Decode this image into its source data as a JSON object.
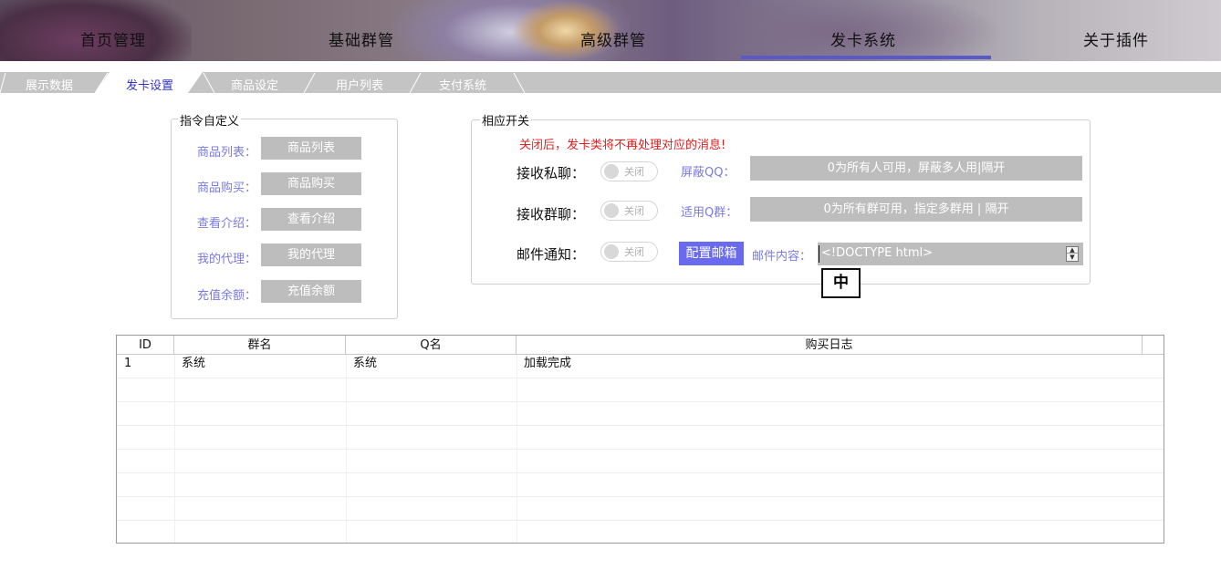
{
  "nav": {
    "items": [
      "首页管理",
      "基础群管",
      "高级群管",
      "发卡系统",
      "关于插件"
    ],
    "active_index": 3,
    "active_color": "#5959c8"
  },
  "tabs": {
    "items": [
      "展示数据",
      "发卡设置",
      "商品设定",
      "用户列表",
      "支付系统"
    ],
    "active_index": 1,
    "active_color": "#3333cc"
  },
  "commands": {
    "title": "指令自定义",
    "items": [
      {
        "label": "商品列表：",
        "value": "商品列表"
      },
      {
        "label": "商品购买：",
        "value": "商品购买"
      },
      {
        "label": "查看介绍：",
        "value": "查看介绍"
      },
      {
        "label": "我的代理：",
        "value": "我的代理"
      },
      {
        "label": "充值余额：",
        "value": "充值余额"
      }
    ]
  },
  "switches": {
    "title": "相应开关",
    "warning": "关闭后，发卡类将不再处理对应的消息!",
    "private_chat": {
      "label": "接收私聊：",
      "toggle": "关闭",
      "side_label": "屏蔽QQ：",
      "placeholder": "0为所有人可用，屏蔽多人用|隔开"
    },
    "group_chat": {
      "label": "接收群聊：",
      "toggle": "关闭",
      "side_label": "适用Q群：",
      "placeholder": "0为所有群可用，指定多群用 | 隔开"
    },
    "mail": {
      "label": "邮件通知：",
      "toggle": "关闭",
      "config_button": "配置邮箱",
      "content_label": "邮件内容：",
      "content_value": "<!DOCTYPE html>"
    },
    "ime_indicator": "中"
  },
  "table": {
    "columns": [
      "ID",
      "群名",
      "Q名",
      "购买日志"
    ],
    "rows": [
      [
        "1",
        "系统",
        "系统",
        "加载完成"
      ]
    ]
  }
}
